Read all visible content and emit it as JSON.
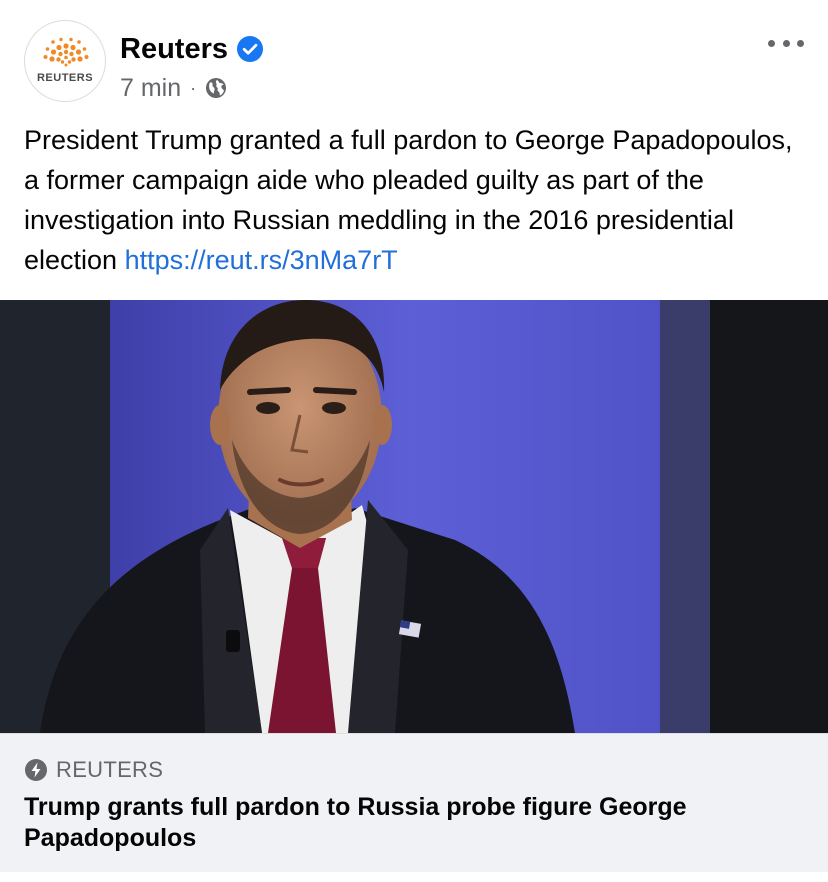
{
  "post": {
    "page_name": "Reuters",
    "avatar_label": "REUTERS",
    "verified_icon": "verified-badge-icon",
    "timestamp": "7 min",
    "separator": "·",
    "audience_icon": "globe-icon",
    "more_icon": "more-options-icon",
    "caption_text": "President Trump granted a full pardon to George Papadopoulos, a former campaign aide who pleaded guilty as part of the investigation into Russian meddling in the 2016 presidential election ",
    "caption_link": "https://reut.rs/3nMa7rT"
  },
  "link_card": {
    "domain_icon": "lightning-bolt-icon",
    "domain": "REUTERS",
    "headline": "Trump grants full pardon to Russia probe figure George Papadopoulos"
  },
  "colors": {
    "brand_orange": "#f08a24",
    "verified_blue": "#1877f2",
    "link_blue": "#216fdb",
    "secondary_text": "#65676b",
    "card_background": "#f0f2f5"
  }
}
